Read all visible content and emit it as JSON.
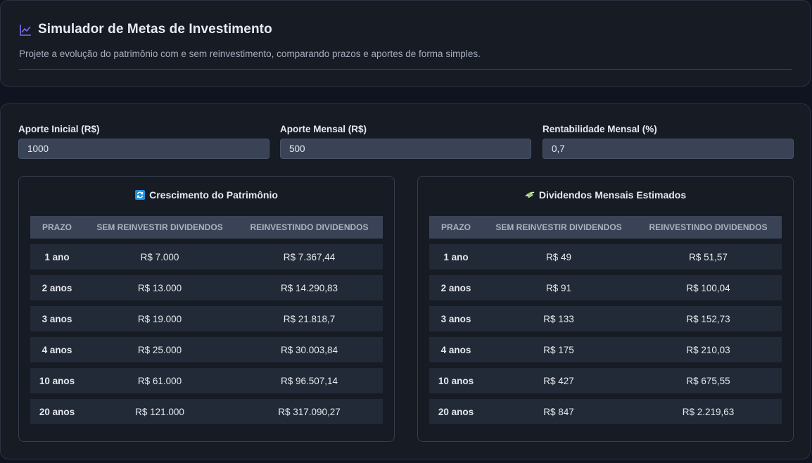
{
  "header": {
    "title": "Simulador de Metas de Investimento",
    "subtitle": "Projete a evolução do patrimônio com e sem reinvestimento, comparando prazos e aportes de forma simples.",
    "icon": "chart-line-icon",
    "accent": "#7c6cf0"
  },
  "inputs": {
    "aporte_inicial": {
      "label": "Aporte Inicial (R$)",
      "value": "1000"
    },
    "aporte_mensal": {
      "label": "Aporte Mensal (R$)",
      "value": "500"
    },
    "rentabilidade": {
      "label": "Rentabilidade Mensal (%)",
      "value": "0,7"
    }
  },
  "patrimonio": {
    "title": "Crescimento do Patrimônio",
    "icon": "refresh-icon",
    "headers": [
      "PRAZO",
      "SEM REINVESTIR DIVIDENDOS",
      "REINVESTINDO DIVIDENDOS"
    ],
    "rows": [
      [
        "1 ano",
        "R$ 7.000",
        "R$ 7.367,44"
      ],
      [
        "2 anos",
        "R$ 13.000",
        "R$ 14.290,83"
      ],
      [
        "3 anos",
        "R$ 19.000",
        "R$ 21.818,7"
      ],
      [
        "4 anos",
        "R$ 25.000",
        "R$ 30.003,84"
      ],
      [
        "10 anos",
        "R$ 61.000",
        "R$ 96.507,14"
      ],
      [
        "20 anos",
        "R$ 121.000",
        "R$ 317.090,27"
      ]
    ]
  },
  "dividendos": {
    "title": "Dividendos Mensais Estimados",
    "icon": "money-wings-icon",
    "headers": [
      "PRAZO",
      "SEM REINVESTIR DIVIDENDOS",
      "REINVESTINDO DIVIDENDOS"
    ],
    "rows": [
      [
        "1 ano",
        "R$ 49",
        "R$ 51,57"
      ],
      [
        "2 anos",
        "R$ 91",
        "R$ 100,04"
      ],
      [
        "3 anos",
        "R$ 133",
        "R$ 152,73"
      ],
      [
        "4 anos",
        "R$ 175",
        "R$ 210,03"
      ],
      [
        "10 anos",
        "R$ 427",
        "R$ 675,55"
      ],
      [
        "20 anos",
        "R$ 847",
        "R$ 2.219,63"
      ]
    ]
  }
}
